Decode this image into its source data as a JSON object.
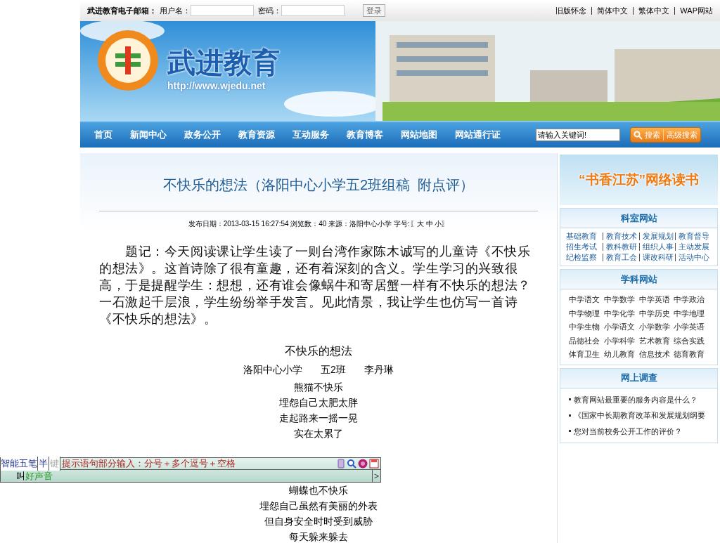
{
  "top_bar": {
    "mail_label": "武进教育电子邮箱：",
    "username_label": "用户名：",
    "password_label": "密码：",
    "login_button": "登录",
    "links": [
      "旧版怀念",
      "简体中文",
      "繁体中文",
      "WAP网站"
    ]
  },
  "banner": {
    "title": "武进教育",
    "url": "http://www.wjedu.net"
  },
  "nav": {
    "items": [
      "首页",
      "新闻中心",
      "政务公开",
      "教育资源",
      "互动服务",
      "教育博客",
      "网站地图",
      "网站通行证"
    ],
    "search": {
      "placeholder": "请输入关键词!"
    },
    "search_button": "搜索",
    "advanced_button": "高级搜索"
  },
  "article": {
    "title": "不快乐的想法（洛阳中心小学五2班组稿  附点评）",
    "meta": "发布日期：2013-03-15 16:27:54 浏览数：40 来源：洛阳中心小学 字号:〖大 中 小〗",
    "intro": "题记：今天阅读课让学生读了一则台湾作家陈木诚写的儿童诗《不快乐的想法》。这首诗除了很有童趣，还有着深刻的含义。学生学习的兴致很高，于是提醒学生：想想，还有谁会像蜗牛和寄居蟹一样有不快乐的想法？一石激起千层浪，学生纷纷举手发言。见此情景，我让学生也仿写一首诗《不快乐的想法》。",
    "poem": {
      "title": "不快乐的想法",
      "byline": [
        "洛阳中心小学",
        "五2班",
        "李丹琳"
      ],
      "lines": [
        {
          "kind": "line",
          "text": "熊猫不快乐"
        },
        {
          "kind": "line",
          "text": "埋怨自己太肥太胖"
        },
        {
          "kind": "line",
          "text": "走起路来一摇一晃"
        },
        {
          "kind": "line",
          "text": "实在太累了"
        },
        {
          "kind": "covered"
        },
        {
          "kind": "line",
          "text": "蝴蝶也不快乐"
        },
        {
          "kind": "line",
          "text": "埋怨自己虽然有美丽的外表"
        },
        {
          "kind": "line",
          "text": "但自身安全时时受到威胁"
        },
        {
          "kind": "line",
          "text": "每天躲来躲去"
        }
      ]
    }
  },
  "sidebar": {
    "promo": "“书香江苏”网络读书",
    "sections": [
      {
        "kind": "links",
        "title": "科室网站",
        "items": [
          "基础教育",
          "教育技术",
          "发展规划",
          "教育督导",
          "招生考试",
          "教科教研",
          "组织人事",
          "主动发展",
          "纪检监察",
          "教育工会",
          "课改科研",
          "活动中心"
        ]
      },
      {
        "kind": "grid",
        "title": "学科网站",
        "items": [
          "中学语文",
          "中学数学",
          "中学英语",
          "中学政治",
          "中学物理",
          "中学化学",
          "中学历史",
          "中学地理",
          "中学生物",
          "小学语文",
          "小学数学",
          "小学英语",
          "品德社会",
          "小学科学",
          "艺术教育",
          "综合实践",
          "体育卫生",
          "幼儿教育",
          "信息技术",
          "德育教育"
        ]
      },
      {
        "kind": "list",
        "title": "网上调查",
        "items": [
          "教育网站最重要的服务内容是什么？",
          "《国家中长期教育改革和发展规划纲要",
          "您对当前校务公开工作的评价？"
        ]
      }
    ]
  },
  "ime_bar": {
    "mode": "智能五笔",
    "half": "半",
    "key": "键",
    "hint": "提示语句部分输入：分号＋多个逗号＋空格",
    "candidate_prefix": "叫",
    "candidate": "好声音",
    "next": ">"
  }
}
